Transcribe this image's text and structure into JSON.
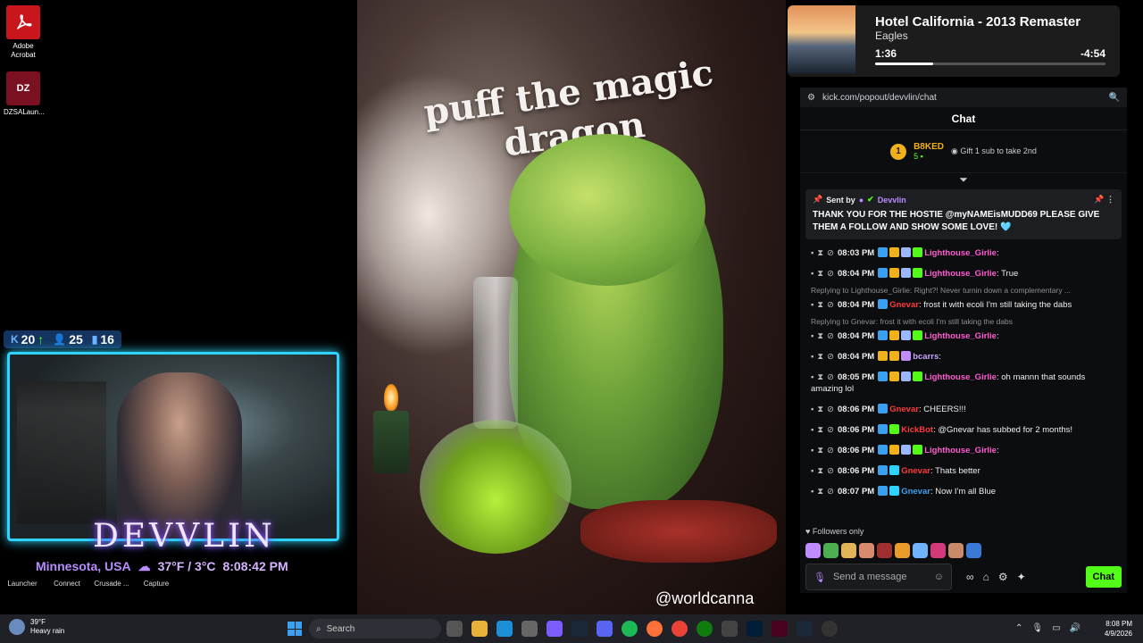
{
  "desktop": {
    "icons": [
      {
        "label": "Adobe Acrobat",
        "icon": "acrobat-icon"
      },
      {
        "label": "DZSALaun...",
        "icon": "dzsa-launcher-icon"
      }
    ]
  },
  "stream_stats": {
    "kick": "20",
    "followers": "25",
    "viewers": "16"
  },
  "overlay": {
    "brand": "DEVVLIN",
    "location": "Minnesota, USA",
    "weather": "37°F / 3°C",
    "time": "8:08:42 PM",
    "shortcuts": [
      "Launcher",
      "Connect",
      "Crusade ...",
      "Capture"
    ]
  },
  "art": {
    "title": "puff the magic dragon",
    "watermark": "@worldcanna"
  },
  "now_playing": {
    "song": "Hotel California - 2013 Remaster",
    "artist": "Eagles",
    "current": "1:36",
    "remaining": "-4:54",
    "progress": 0.25
  },
  "chat": {
    "url": "kick.com/popout/devvlin/chat",
    "header": "Chat",
    "leader": {
      "rank": "1",
      "name": "B8KED",
      "count": "5",
      "gift_text": "Gift 1 sub to take 2nd"
    },
    "pinned": {
      "sent_by": "Sent by",
      "author": "Devvlin",
      "message": "THANK YOU FOR THE HOSTIE @myNAMEisMUDD69 PLEASE GIVE THEM A FOLLOW AND SHOW SOME LOVE! 🩵"
    },
    "messages": [
      {
        "time": "08:03 PM",
        "user": "Lighthouse_Girlie",
        "color": "#ff5cd0",
        "text": "",
        "badges": [
          "#3aa0f0",
          "#f1b11a",
          "#9ab7ff",
          "#53fc18"
        ]
      },
      {
        "time": "08:04 PM",
        "user": "Lighthouse_Girlie",
        "color": "#ff5cd0",
        "text": "True",
        "badges": [
          "#3aa0f0",
          "#f1b11a",
          "#9ab7ff",
          "#53fc18"
        ]
      },
      {
        "reply": "Replying to Lighthouse_Girlie: Right?! Never turnin down a complementary ...",
        "time": "08:04 PM",
        "user": "Gnevar",
        "color": "#ff3b3b",
        "text": "frost it with ecoli I'm still taking the dabs",
        "badges": [
          "#3aa0f0"
        ]
      },
      {
        "reply": "Replying to Gnevar: frost it with ecoli I'm still taking the dabs",
        "time": "08:04 PM",
        "user": "Lighthouse_Girlie",
        "color": "#ff5cd0",
        "text": "",
        "badges": [
          "#3aa0f0",
          "#f1b11a",
          "#9ab7ff",
          "#53fc18"
        ]
      },
      {
        "time": "08:04 PM",
        "user": "bcarrs",
        "color": "#c8a4ff",
        "text": "",
        "badges": [
          "#f1b11a",
          "#f1b11a",
          "#c08cff"
        ]
      },
      {
        "time": "08:05 PM",
        "user": "Lighthouse_Girlie",
        "color": "#ff5cd0",
        "text": "oh mannn that sounds amazing lol",
        "badges": [
          "#3aa0f0",
          "#f1b11a",
          "#9ab7ff",
          "#53fc18"
        ]
      },
      {
        "time": "08:06 PM",
        "user": "Gnevar",
        "color": "#ff3b3b",
        "text": "CHEERS!!!",
        "badges": [
          "#3aa0f0"
        ]
      },
      {
        "time": "08:06 PM",
        "user": "KickBot",
        "color": "#ff3b3b",
        "text": "@Gnevar has subbed for 2 months!",
        "badges": [
          "#3aa0f0",
          "#53fc18"
        ]
      },
      {
        "time": "08:06 PM",
        "user": "Lighthouse_Girlie",
        "color": "#ff5cd0",
        "text": "",
        "badges": [
          "#3aa0f0",
          "#f1b11a",
          "#9ab7ff",
          "#53fc18"
        ]
      },
      {
        "time": "08:06 PM",
        "user": "Gnevar",
        "color": "#ff3b3b",
        "text": "Thats better",
        "badges": [
          "#3aa0f0",
          "#2fd3ff"
        ]
      },
      {
        "time": "08:07 PM",
        "user": "Gnevar",
        "color": "#3aa0f0",
        "text": "Now I'm all Blue",
        "badges": [
          "#3aa0f0",
          "#2fd3ff"
        ]
      }
    ],
    "followers_only": "Followers only",
    "input_placeholder": "Send a message",
    "send_label": "Chat"
  },
  "taskbar": {
    "weather_temp": "39°F",
    "weather_desc": "Heavy rain",
    "search_placeholder": "Search",
    "time": "8:08 PM",
    "date": "4/9/2026"
  }
}
